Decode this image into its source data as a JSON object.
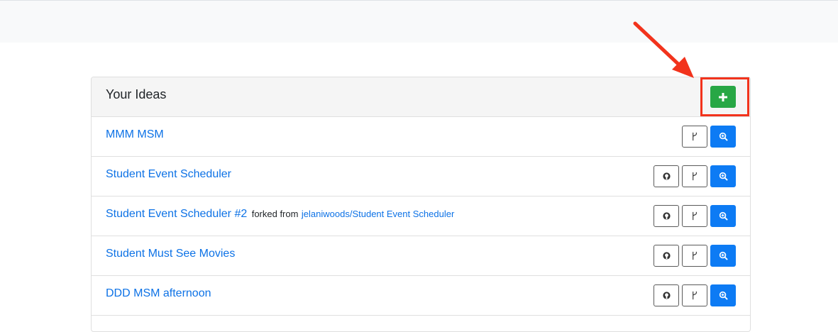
{
  "card": {
    "title": "Your Ideas",
    "add_button_icon": "plus-icon",
    "accent_add": "#28a745",
    "accent_primary": "#0d7bf4",
    "link_color": "#0d72e6"
  },
  "annotation": {
    "arrow_color": "#f2331c"
  },
  "ideas": [
    {
      "title": "MMM MSM",
      "forked_text": "",
      "forked_link": "",
      "has_github": false
    },
    {
      "title": "Student Event Scheduler",
      "forked_text": "",
      "forked_link": "",
      "has_github": true
    },
    {
      "title": "Student Event Scheduler #2",
      "forked_text": "forked from",
      "forked_link": "jelaniwoods/Student Event Scheduler",
      "has_github": true
    },
    {
      "title": "Student Must See Movies",
      "forked_text": "",
      "forked_link": "",
      "has_github": true
    },
    {
      "title": "DDD MSM afternoon",
      "forked_text": "",
      "forked_link": "",
      "has_github": true
    }
  ],
  "row_actions": {
    "github_icon": "github-icon",
    "fork_icon": "code-fork-icon",
    "view_icon": "search-plus-icon"
  }
}
